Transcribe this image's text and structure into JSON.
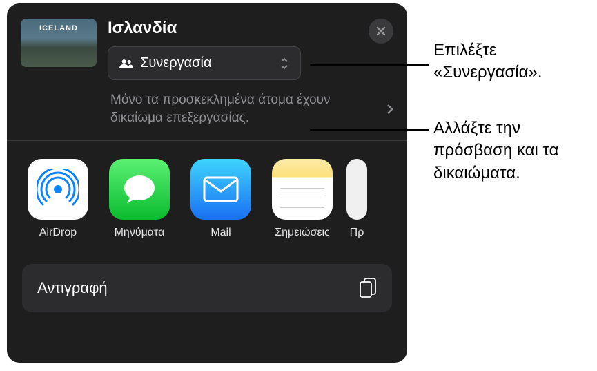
{
  "header": {
    "title": "Ισλανδία",
    "thumbnail_label": "ICELAND"
  },
  "dropdown": {
    "label": "Συνεργασία"
  },
  "permissions": {
    "text": "Μόνο τα προσκεκλημένα άτομα έχουν δικαίωμα επεξεργασίας."
  },
  "apps": [
    {
      "label": "AirDrop"
    },
    {
      "label": "Μηνύματα"
    },
    {
      "label": "Mail"
    },
    {
      "label": "Σημειώσεις"
    },
    {
      "label": "Πρ"
    }
  ],
  "actions": {
    "copy": "Αντιγραφή"
  },
  "callouts": {
    "select_collab": "Επιλέξτε «Συνεργασία».",
    "change_access": "Αλλάξτε την πρόσβαση και τα δικαιώματα."
  }
}
